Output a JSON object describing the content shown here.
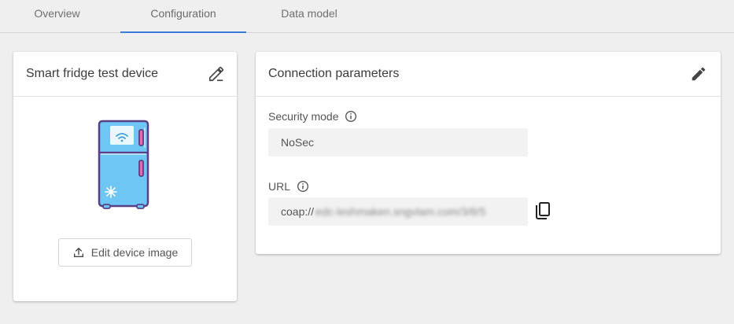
{
  "tabs": [
    {
      "label": "Overview"
    },
    {
      "label": "Configuration"
    },
    {
      "label": "Data model"
    }
  ],
  "device_card": {
    "title": "Smart fridge test device",
    "edit_icon": "edit-icon",
    "image_icon": "smart-fridge-icon",
    "edit_image_label": "Edit device image",
    "upload_icon": "upload-icon"
  },
  "connection_card": {
    "title": "Connection parameters",
    "edit_icon": "edit-icon",
    "security_mode": {
      "label": "Security mode",
      "info_icon": "info-icon",
      "value": "NoSec"
    },
    "url": {
      "label": "URL",
      "info_icon": "info-icon",
      "value_prefix": "coap://",
      "value_obscured": "edc-leshmaken.sngvlam.com/3/8/5",
      "copy_icon": "copy-icon"
    }
  },
  "colors": {
    "accent": "#3d7bd8",
    "fridge_body": "#6ec6f5",
    "fridge_outline": "#5b3f86"
  }
}
